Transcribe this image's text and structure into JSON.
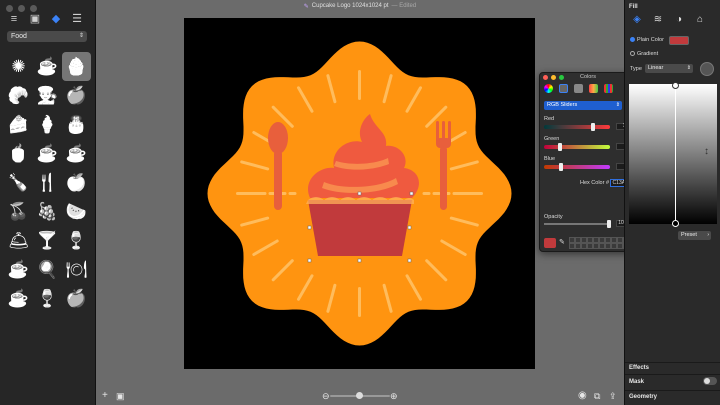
{
  "window": {
    "title": "Cupcake Logo 1024x1024 pt",
    "status": "— Edited"
  },
  "sidebar": {
    "tools": [
      {
        "icon": "list-icon",
        "glyph": "≡"
      },
      {
        "icon": "image-icon",
        "glyph": "▣"
      },
      {
        "icon": "shapes-icon",
        "glyph": "◆"
      },
      {
        "icon": "layers-icon",
        "glyph": "☰"
      }
    ],
    "category": "Food",
    "icons": [
      {
        "name": "orange-slice-icon",
        "glyph": "✺"
      },
      {
        "name": "coffee-cup-icon",
        "glyph": "☕"
      },
      {
        "name": "cupcake-icon",
        "glyph": "🧁"
      },
      {
        "name": "croissant-icon",
        "glyph": "🥐"
      },
      {
        "name": "chef-hat-icon",
        "glyph": "👨‍🍳"
      },
      {
        "name": "apple-icon",
        "glyph": "🍎"
      },
      {
        "name": "cake-slice-icon",
        "glyph": "🍰"
      },
      {
        "name": "ice-cream-icon",
        "glyph": "🍦"
      },
      {
        "name": "birthday-cake-icon",
        "glyph": "🎂"
      },
      {
        "name": "teacup-icon",
        "glyph": "🍵"
      },
      {
        "name": "mug-icon",
        "glyph": "☕"
      },
      {
        "name": "tea-cup-saucer-icon",
        "glyph": "☕"
      },
      {
        "name": "bottle-icon",
        "glyph": "🍾"
      },
      {
        "name": "cutlery-icon",
        "glyph": "🍴"
      },
      {
        "name": "apple-outline-icon",
        "glyph": "🍏"
      },
      {
        "name": "cherries-icon",
        "glyph": "🍒"
      },
      {
        "name": "grapes-icon",
        "glyph": "🍇"
      },
      {
        "name": "watermelon-icon",
        "glyph": "🍉"
      },
      {
        "name": "cloche-icon",
        "glyph": "🛎"
      },
      {
        "name": "cocktail-icon",
        "glyph": "🍸"
      },
      {
        "name": "wine-glass-icon",
        "glyph": "🍷"
      },
      {
        "name": "coffee-saucer-icon",
        "glyph": "☕"
      },
      {
        "name": "grill-icon",
        "glyph": "🍳"
      },
      {
        "name": "plate-icon",
        "glyph": "🍽"
      },
      {
        "name": "cup-icon",
        "glyph": "☕"
      },
      {
        "name": "wine-bottle-icon",
        "glyph": "🍷"
      },
      {
        "name": "apple-core-icon",
        "glyph": "🍎"
      }
    ]
  },
  "colors_panel": {
    "title": "Colors",
    "mode": "RGB Sliders",
    "red": {
      "label": "Red",
      "value": "193",
      "fraction": 0.76
    },
    "green": {
      "label": "Green",
      "value": "58",
      "fraction": 0.23
    },
    "blue": {
      "label": "Blue",
      "value": "60",
      "fraction": 0.24
    },
    "hex_label": "Hex Color #",
    "hex_value": "C13A3C",
    "opacity_label": "Opacity",
    "opacity_value": "100%",
    "current_color": "#c13a3c"
  },
  "inspector": {
    "fill_heading": "Fill",
    "plain_color_label": "Plain Color",
    "gradient_label": "Gradient",
    "type_label": "Type",
    "type_value": "Linear",
    "preset_label": "Preset",
    "effects_label": "Effects",
    "mask_label": "Mask",
    "geometry_label": "Geometry"
  },
  "colors": {
    "badge": "#ff9410",
    "cupcake_wrapper": "#c13a3c",
    "cupcake_frosting": "#ef5a3f",
    "utensils": "#e85f3c",
    "rays": "#ffc36a"
  }
}
